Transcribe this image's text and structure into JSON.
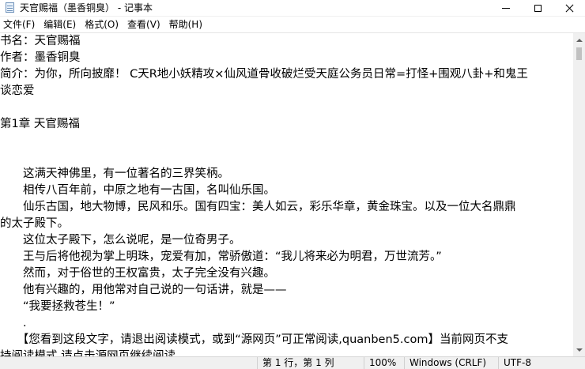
{
  "window": {
    "title": "天官赐福（墨香铜臭） - 记事本",
    "icon": "notepad-icon"
  },
  "menu": [
    {
      "label": "文件(F)"
    },
    {
      "label": "编辑(E)"
    },
    {
      "label": "格式(O)"
    },
    {
      "label": "查看(V)"
    },
    {
      "label": "帮助(H)"
    }
  ],
  "document": {
    "lines": [
      "书名：天官赐福",
      "作者：墨香铜臭",
      "简介：为你，所向披靡！ C天R地小妖精攻×仙风道骨收破烂受天庭公务员日常=打怪+围观八卦+和鬼王",
      "谈恋爱",
      "",
      "第1章 天官赐福",
      "",
      "",
      "　　这满天神佛里，有一位著名的三界笑柄。",
      "　　相传八百年前，中原之地有一古国，名叫仙乐国。",
      "　　仙乐古国，地大物博，民风和乐。国有四宝：美人如云，彩乐华章，黄金珠宝。以及一位大名鼎鼎",
      "的太子殿下。",
      "　　这位太子殿下，怎么说呢，是一位奇男子。",
      "　　王与后将他视为掌上明珠，宠爱有加，常骄傲道：“我儿将来必为明君，万世流芳。”",
      "　　然而，对于俗世的王权富贵，太子完全没有兴趣。",
      "　　他有兴趣的，用他常对自己说的一句话讲，就是——",
      "　　“我要拯救苍生！”",
      "　　.",
      "　　【您看到这段文字，请退出阅读模式，或到“源网页”可正常阅读,quanben5.com】当前网页不支",
      "持阅读模式,请点击源网页继续阅读。"
    ]
  },
  "status": {
    "position": "第 1 行，第 1 列",
    "zoom": "100%",
    "line_ending": "Windows (CRLF)",
    "encoding": "UTF-8"
  },
  "colors": {
    "statusbar_bg": "#f0f0f0",
    "scrollbar_bg": "#f0f0f0"
  }
}
